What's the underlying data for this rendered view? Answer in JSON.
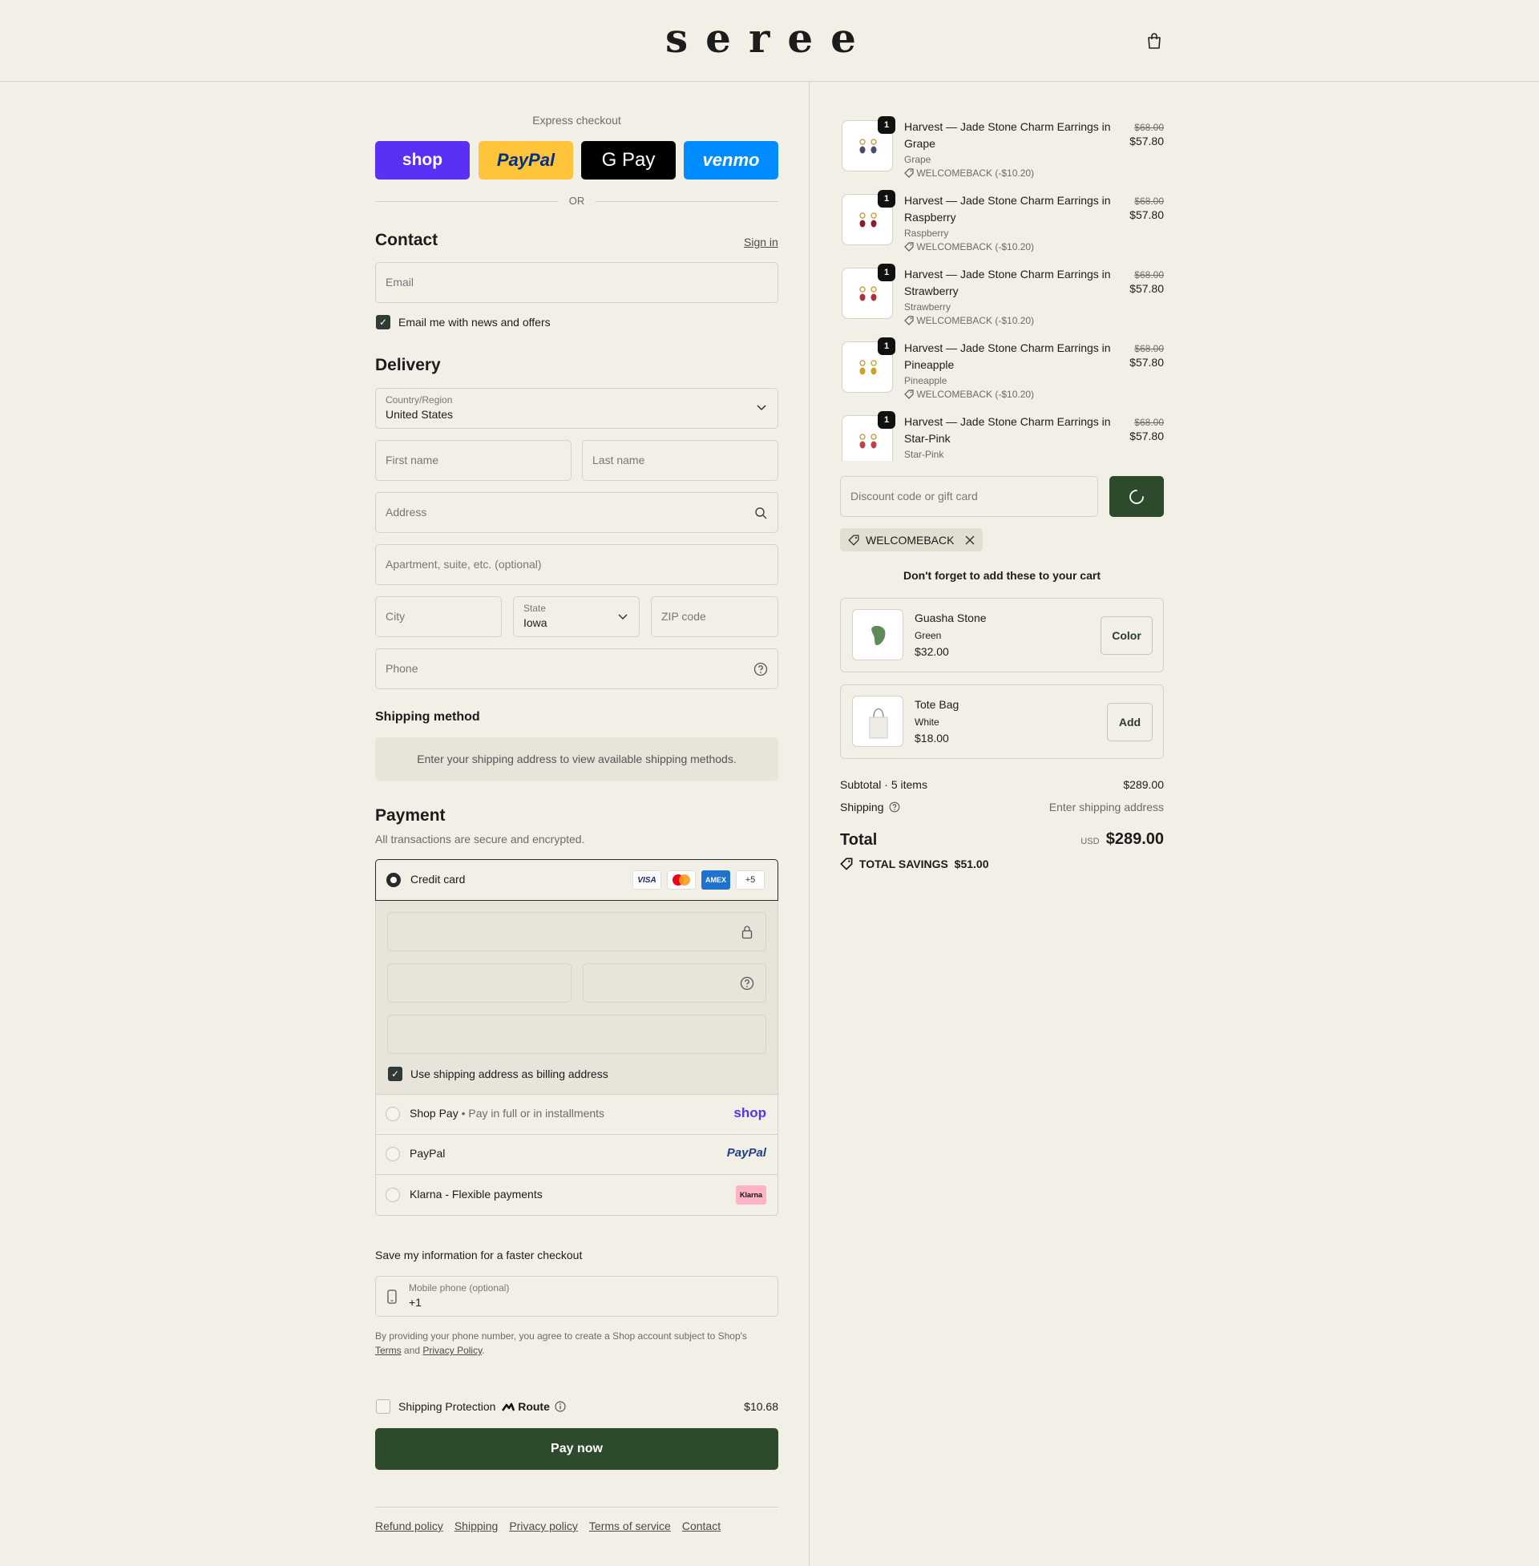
{
  "brand": {
    "name": "seree"
  },
  "express": {
    "label": "Express checkout",
    "or": "OR",
    "buttons": [
      {
        "label": "shop"
      },
      {
        "label": "PayPal"
      },
      {
        "label": "G Pay"
      },
      {
        "label": "venmo"
      }
    ]
  },
  "contact": {
    "title": "Contact",
    "sign_in": "Sign in",
    "email_placeholder": "Email",
    "newsletter_label": "Email me with news and offers"
  },
  "delivery": {
    "title": "Delivery",
    "country_label": "Country/Region",
    "country_value": "United States",
    "first_name": "First name",
    "last_name": "Last name",
    "address": "Address",
    "apartment": "Apartment, suite, etc. (optional)",
    "city": "City",
    "state_label": "State",
    "state_value": "Iowa",
    "zip": "ZIP code",
    "phone": "Phone"
  },
  "shipping_method": {
    "title": "Shipping method",
    "message": "Enter your shipping address to view available shipping methods."
  },
  "payment": {
    "title": "Payment",
    "subtitle": "All transactions are secure and encrypted.",
    "credit_card": "Credit card",
    "more_cards": "+5",
    "billing_same": "Use shipping address as billing address",
    "shop_pay": "Shop Pay",
    "shop_pay_desc": "Pay in full or in installments",
    "shop_pay_logo": "shop",
    "paypal": "PayPal",
    "paypal_logo": "PayPal",
    "klarna": "Klarna - Flexible payments",
    "klarna_logo": "Klarna",
    "card_logos": {
      "visa": "VISA",
      "amex": "AMEX"
    }
  },
  "save_info": {
    "title": "Save my information for a faster checkout",
    "phone_label": "Mobile phone (optional)",
    "phone_value": "+1",
    "legal_pre": "By providing your phone number, you agree to create a Shop account subject to Shop's",
    "terms": "Terms",
    "and": "and",
    "privacy": "Privacy Policy",
    "period": "."
  },
  "protection": {
    "label": "Shipping Protection",
    "brand": "Route",
    "price": "$10.68"
  },
  "pay_now": "Pay now",
  "footer_links": [
    "Refund policy",
    "Shipping",
    "Privacy policy",
    "Terms of service",
    "Contact"
  ],
  "cart": {
    "items": [
      {
        "name": "Harvest — Jade Stone Charm Earrings in Grape",
        "variant": "Grape",
        "discount": "WELCOMEBACK (-$10.20)",
        "original": "$68.00",
        "price": "$57.80",
        "qty": "1",
        "color": "#4a4a6a"
      },
      {
        "name": "Harvest — Jade Stone Charm Earrings in Raspberry",
        "variant": "Raspberry",
        "discount": "WELCOMEBACK (-$10.20)",
        "original": "$68.00",
        "price": "$57.80",
        "qty": "1",
        "color": "#8a1e2a"
      },
      {
        "name": "Harvest — Jade Stone Charm Earrings in Strawberry",
        "variant": "Strawberry",
        "discount": "WELCOMEBACK (-$10.20)",
        "original": "$68.00",
        "price": "$57.80",
        "qty": "1",
        "color": "#b0303a"
      },
      {
        "name": "Harvest — Jade Stone Charm Earrings in Pineapple",
        "variant": "Pineapple",
        "discount": "WELCOMEBACK (-$10.20)",
        "original": "$68.00",
        "price": "$57.80",
        "qty": "1",
        "color": "#c9a22a"
      },
      {
        "name": "Harvest — Jade Stone Charm Earrings in Star-Pink",
        "variant": "Star-Pink",
        "original": "$68.00",
        "price": "$57.80",
        "qty": "1",
        "color": "#c0404a"
      }
    ],
    "discount_placeholder": "Discount code or gift card",
    "applied_code": "WELCOMEBACK",
    "upsell_title": "Don't forget to add these to your cart",
    "upsells": [
      {
        "name": "Guasha Stone",
        "variant": "Green",
        "price": "$32.00",
        "button": "Color"
      },
      {
        "name": "Tote Bag",
        "variant": "White",
        "price": "$18.00",
        "button": "Add"
      }
    ],
    "subtotal_label": "Subtotal · 5 items",
    "subtotal": "$289.00",
    "shipping_label": "Shipping",
    "shipping_value": "Enter shipping address",
    "total_label": "Total",
    "currency": "USD",
    "total": "$289.00",
    "savings_label": "TOTAL SAVINGS",
    "savings": "$51.00"
  }
}
